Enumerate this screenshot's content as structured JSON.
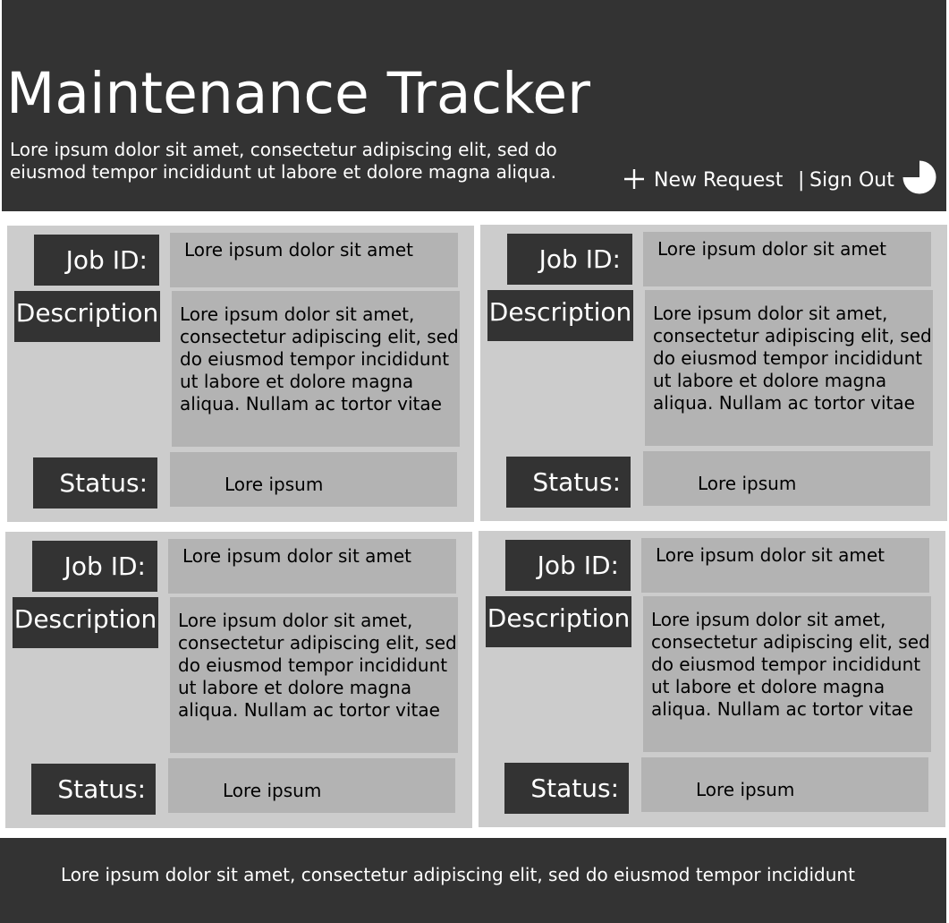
{
  "header": {
    "title": "Maintenance Tracker",
    "subtitle_lines": [
      "Lore ipsum dolor sit amet, consectetur adipiscing elit, sed do",
      "eiusmod tempor incididunt ut labore et dolore magna aliqua."
    ],
    "new_request": {
      "icon": "plus-icon",
      "label": "New Request"
    },
    "separator": "|",
    "sign_out": {
      "label": "Sign Out"
    },
    "account_icon": "pie-chart-icon"
  },
  "field_labels": {
    "job_id": "Job ID:",
    "description": "Description",
    "status": "Status:"
  },
  "cards": [
    {
      "job_id": "Lore ipsum dolor sit amet",
      "description_lines": [
        "Lore ipsum dolor sit amet,",
        "consectetur adipiscing elit, sed",
        "do eiusmod tempor incididunt",
        "ut labore et dolore magna",
        "aliqua. Nullam ac tortor vitae"
      ],
      "status": "Lore ipsum"
    },
    {
      "job_id": "Lore ipsum dolor sit amet",
      "description_lines": [
        "Lore ipsum dolor sit amet,",
        "consectetur adipiscing elit, sed",
        "do eiusmod tempor incididunt",
        "ut labore et dolore magna",
        "aliqua. Nullam ac tortor vitae"
      ],
      "status": "Lore ipsum"
    },
    {
      "job_id": "Lore ipsum dolor sit amet",
      "description_lines": [
        "Lore ipsum dolor sit amet,",
        "consectetur adipiscing elit, sed",
        "do eiusmod tempor incididunt",
        "ut labore et dolore magna",
        "aliqua. Nullam ac tortor vitae"
      ],
      "status": "Lore ipsum"
    },
    {
      "job_id": "Lore ipsum dolor sit amet",
      "description_lines": [
        "Lore ipsum dolor sit amet,",
        "consectetur adipiscing elit, sed",
        "do eiusmod tempor incididunt",
        "ut labore et dolore magna",
        "aliqua. Nullam ac tortor vitae"
      ],
      "status": "Lore ipsum"
    }
  ],
  "footer": {
    "text": "Lore ipsum dolor sit amet, consectetur adipiscing elit, sed do eiusmod tempor incididunt"
  },
  "colors": {
    "header_bg": "#333333",
    "card_bg": "#cccccc",
    "field_bg": "#b3b3b3",
    "label_bg": "#333333",
    "text_light": "#ffffff",
    "text_dark": "#000000"
  }
}
